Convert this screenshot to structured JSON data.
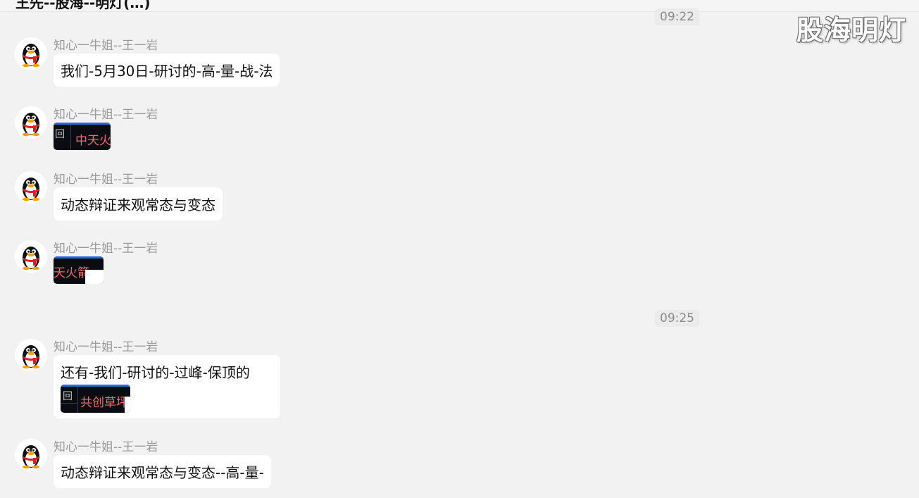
{
  "header": {
    "title_partial": "王先--股海--明灯(…)"
  },
  "watermark": "股海明灯",
  "colors": {
    "background": "#f2f2f2",
    "bubble": "#ffffff",
    "sender_name": "#9a9a9a",
    "thumb_label": "#f06a6a"
  },
  "icons": {
    "avatar": "qq-penguin-icon"
  },
  "timestamps": [
    "09:22",
    "09:25"
  ],
  "messages": [
    {
      "sender": "知心一牛姐--王一岩",
      "text": "我们-5月30日-研讨的-高-量-战-法"
    },
    {
      "sender": "知心一牛姐--王一岩",
      "image_text_left": "回",
      "image_text": "中天火"
    },
    {
      "sender": "知心一牛姐--王一岩",
      "text": "动态辩证来观常态与变态"
    },
    {
      "sender": "知心一牛姐--王一岩",
      "image_text": "天火箭"
    },
    {
      "sender": "知心一牛姐--王一岩",
      "text": "还有-我们-研讨的-过峰-保顶的",
      "image_text_left": "回",
      "image_text": "共创草坪"
    },
    {
      "sender": "知心一牛姐--王一岩",
      "text": "动态辩证来观常态与变态--高-量-"
    }
  ]
}
